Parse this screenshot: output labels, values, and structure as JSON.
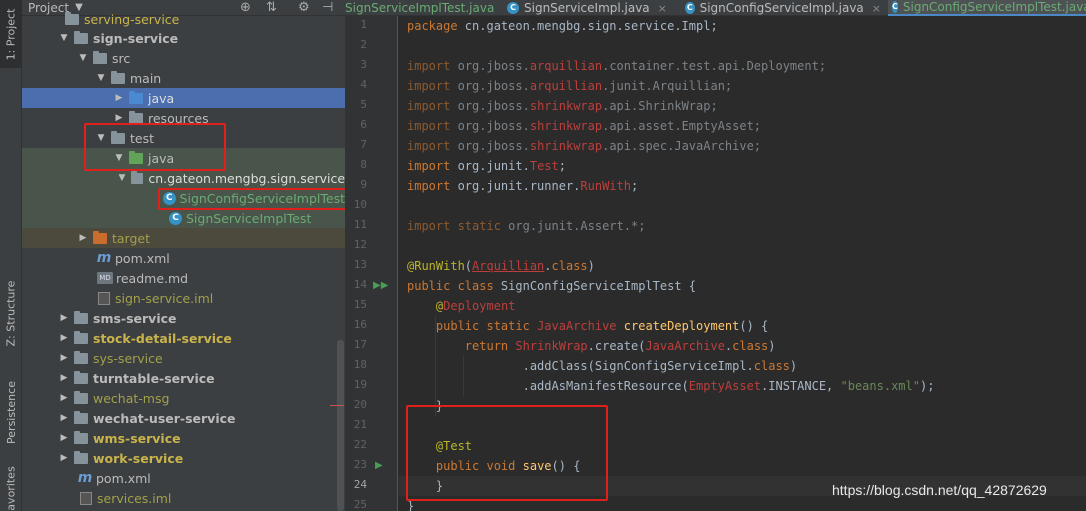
{
  "tool_stripe": {
    "project_tab": "1: Project",
    "structure_tab": "Z: Structure",
    "persistence_tab": "Persistence",
    "favorites_tab": "avorites"
  },
  "project_panel": {
    "title": "Project",
    "tree": [
      {
        "label": "serving-service",
        "arrow": "",
        "icon": "folder",
        "style": "gold"
      },
      {
        "label": "sign-service",
        "arrow": "▼",
        "icon": "folder",
        "style": "bold"
      },
      {
        "label": "src",
        "arrow": "▼",
        "icon": "folder",
        "style": ""
      },
      {
        "label": "main",
        "arrow": "▼",
        "icon": "folder",
        "style": ""
      },
      {
        "label": "java",
        "arrow": "▶",
        "icon": "folder-blue",
        "style": ""
      },
      {
        "label": "resources",
        "arrow": "▶",
        "icon": "folder-res",
        "style": ""
      },
      {
        "label": "test",
        "arrow": "▼",
        "icon": "folder",
        "style": ""
      },
      {
        "label": "java",
        "arrow": "▼",
        "icon": "folder-green",
        "style": ""
      },
      {
        "label": "cn.gateon.mengbg.sign.service",
        "arrow": "▼",
        "icon": "folder",
        "style": "white"
      },
      {
        "label": "SignConfigServiceImplTest",
        "arrow": "",
        "icon": "class",
        "style": "test-green"
      },
      {
        "label": "SignServiceImplTest",
        "arrow": "",
        "icon": "class",
        "style": "test-green"
      },
      {
        "label": "target",
        "arrow": "▶",
        "icon": "folder-orange",
        "style": "olive"
      },
      {
        "label": "pom.xml",
        "arrow": "",
        "icon": "maven",
        "style": ""
      },
      {
        "label": "readme.md",
        "arrow": "",
        "icon": "md",
        "style": ""
      },
      {
        "label": "sign-service.iml",
        "arrow": "",
        "icon": "iml",
        "style": "olive"
      },
      {
        "label": "sms-service",
        "arrow": "▶",
        "icon": "folder",
        "style": "bold"
      },
      {
        "label": "stock-detail-service",
        "arrow": "▶",
        "icon": "folder",
        "style": "bold gold"
      },
      {
        "label": "sys-service",
        "arrow": "▶",
        "icon": "folder",
        "style": "olive"
      },
      {
        "label": "turntable-service",
        "arrow": "▶",
        "icon": "folder",
        "style": "bold"
      },
      {
        "label": "wechat-msg",
        "arrow": "▶",
        "icon": "folder",
        "style": "olive"
      },
      {
        "label": "wechat-user-service",
        "arrow": "▶",
        "icon": "folder",
        "style": "bold"
      },
      {
        "label": "wms-service",
        "arrow": "▶",
        "icon": "folder",
        "style": "bold gold"
      },
      {
        "label": "work-service",
        "arrow": "▶",
        "icon": "folder",
        "style": "bold gold"
      },
      {
        "label": "pom.xml",
        "arrow": "",
        "icon": "maven",
        "style": ""
      },
      {
        "label": "services.iml",
        "arrow": "",
        "icon": "iml",
        "style": "olive"
      }
    ]
  },
  "tabs": [
    {
      "label": "SignServiceImplTest.java"
    },
    {
      "label": "SignServiceImpl.java"
    },
    {
      "label": "SignConfigServiceImpl.java"
    },
    {
      "label": "SignConfigServiceImplTest.java"
    }
  ],
  "editor": {
    "line_numbers": [
      "1",
      "2",
      "3",
      "4",
      "5",
      "6",
      "7",
      "8",
      "9",
      "10",
      "11",
      "12",
      "13",
      "14",
      "15",
      "16",
      "17",
      "18",
      "19",
      "20",
      "21",
      "22",
      "23",
      "24",
      "25"
    ]
  },
  "watermark": "https://blog.csdn.net/qq_42872629",
  "colors": {
    "selection": "#4b6eaf",
    "test_row": "#49544a",
    "annotation_box": "#e0201a"
  }
}
